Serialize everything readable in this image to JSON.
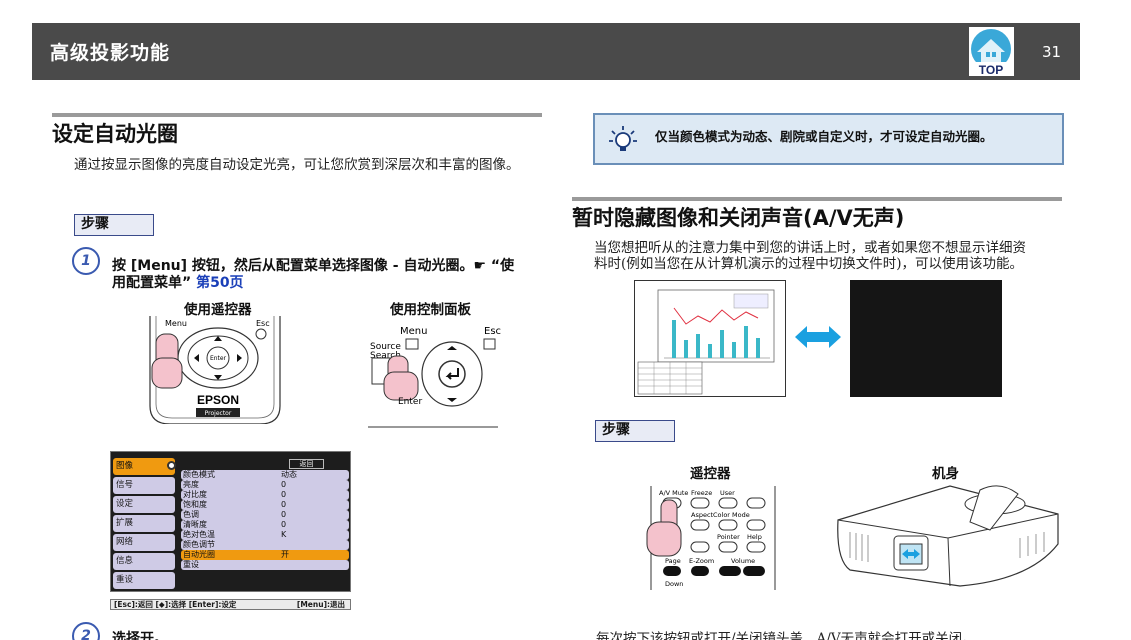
{
  "header": {
    "title": "高级投影功能",
    "top_label": "TOP",
    "page_number": "31"
  },
  "left": {
    "heading": "设定自动光圈",
    "intro": "通过按显示图像的亮度自动设定光亮，可让您欣赏到深层次和丰富的图像。",
    "steps_label": "步骤",
    "step1_num": "1",
    "step1_line1": "按 [Menu] 按钮，然后从配置菜单选择图像 - 自动光圈。☛ “使",
    "step1_line2_text": "用配置菜单”",
    "step1_link": "第50页",
    "remote_label": "使用遥控器",
    "panel_label": "使用控制面板",
    "remote_text": {
      "menu": "Menu",
      "esc": "Esc",
      "enter": "Enter",
      "brand": "EPSON",
      "model": "Projector"
    },
    "panel_text": {
      "menu": "Menu",
      "esc": "Esc",
      "source1": "Source",
      "source2": "Search",
      "enter": "Enter"
    },
    "menu_sidebar": [
      "图像",
      "信号",
      "设定",
      "扩展",
      "网络",
      "信息",
      "重设"
    ],
    "menu_return": "返回",
    "menu_rows": [
      {
        "label": "颜色模式",
        "value": "动态"
      },
      {
        "label": "亮度",
        "value": "0"
      },
      {
        "label": "对比度",
        "value": "0"
      },
      {
        "label": "饱和度",
        "value": "0"
      },
      {
        "label": "色调",
        "value": "0"
      },
      {
        "label": "清晰度",
        "value": "0"
      },
      {
        "label": "绝对色温",
        "value": "K"
      },
      {
        "label": "颜色调节",
        "value": ""
      },
      {
        "label": "自动光圈",
        "value": "开"
      },
      {
        "label": "重设",
        "value": ""
      }
    ],
    "menu_footer_left": "[Esc]:返回 [◆]:选择 [Enter]:设定",
    "menu_footer_right": "[Menu]:退出",
    "step2_num": "2",
    "step2_text": "选择开。"
  },
  "right": {
    "note": "仅当颜色模式为动态、剧院或自定义时，才可设定自动光圈。",
    "heading": "暂时隐藏图像和关闭声音(A/V无声)",
    "intro_line1": "当您想把听从的注意力集中到您的讲话上时，或者如果您不想显示详细资",
    "intro_line2": "料时(例如当您在从计算机演示的过程中切换文件时)，可以使用该功能。",
    "steps_label": "步骤",
    "remote_label": "遥控器",
    "body_label": "机身",
    "remote_keys": {
      "avmute": "A/V Mute",
      "freeze": "Freeze",
      "user": "User",
      "aspect": "Aspect",
      "colormode": "Color Mode",
      "pointer": "Pointer",
      "help": "Help",
      "page": "Page",
      "ezoom": "E-Zoom",
      "volume": "Volume",
      "down": "Down"
    },
    "bottom_text": "每次按下该按钮或打开/关闭镜头盖，A/V无声就会打开或关闭。"
  },
  "colors": {
    "header_bg": "#4a4a4a",
    "link": "#1a3fb8",
    "note_bg": "#dde9f4",
    "arrow": "#1aa0e0",
    "menu_highlight": "#f09a10"
  }
}
